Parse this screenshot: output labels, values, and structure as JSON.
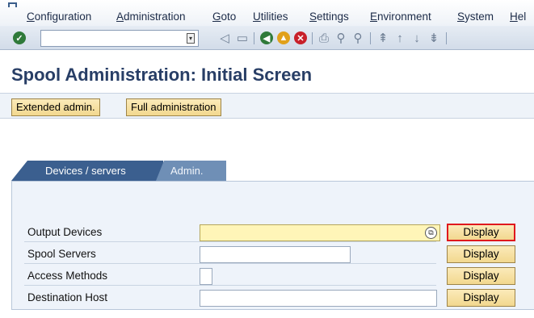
{
  "menu": {
    "items": [
      "Configuration",
      "Administration",
      "Goto",
      "Utilities",
      "Settings",
      "Environment",
      "System",
      "Hel"
    ]
  },
  "toolbar": {
    "command_field_value": "",
    "icons": [
      "enter-icon",
      "back-arrow-icon",
      "save-icon",
      "back-icon",
      "exit-icon",
      "cancel-icon",
      "print-icon",
      "find-icon",
      "find-next-icon",
      "first-page-icon",
      "previous-page-icon",
      "next-page-icon",
      "last-page-icon"
    ]
  },
  "page": {
    "title": "Spool Administration: Initial Screen"
  },
  "app_toolbar": {
    "extended_admin_label": "Extended admin.",
    "full_admin_label": "Full administration"
  },
  "tabs": [
    {
      "label": "Devices / servers",
      "active": true
    },
    {
      "label": "Admin.",
      "active": false
    }
  ],
  "form": {
    "rows": [
      {
        "label": "Output Devices",
        "value": "",
        "button": "Display",
        "required": true
      },
      {
        "label": "Spool Servers",
        "value": "",
        "button": "Display"
      },
      {
        "label": "Access Methods",
        "value": "",
        "button": "Display"
      },
      {
        "label": "Destination Host",
        "value": "",
        "button": "Display"
      }
    ]
  },
  "colors": {
    "title": "#283e66",
    "tab_active": "#3b5f8f",
    "tab_inactive": "#6f8fb6",
    "button": "#f2d88f",
    "required_field": "#fff5b8",
    "focus_border": "#e0181d"
  }
}
